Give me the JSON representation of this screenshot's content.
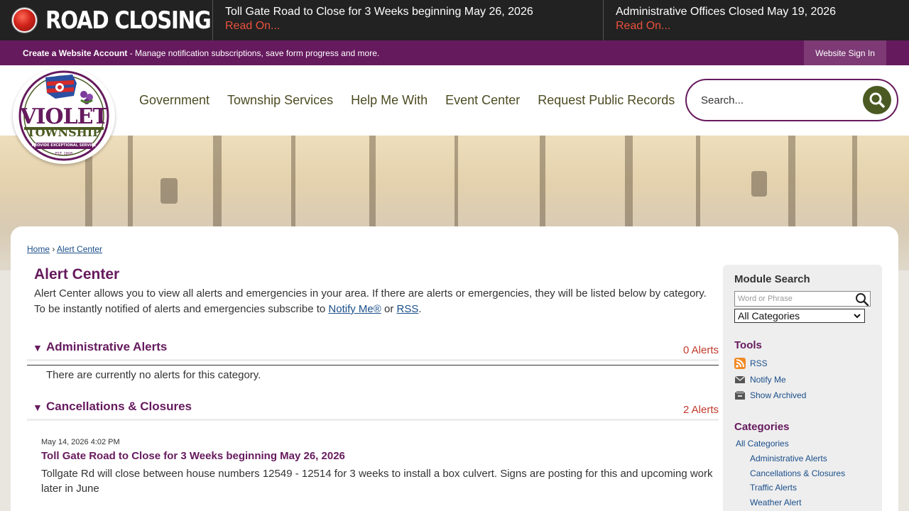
{
  "alert_bar": {
    "label": "ROAD CLOSING",
    "items": [
      {
        "title": "Toll Gate Road to Close for 3 Weeks beginning May 26, 2026",
        "link": "Read On..."
      },
      {
        "title": "Administrative Offices Closed May 19, 2026",
        "link": "Read On..."
      }
    ]
  },
  "account_bar": {
    "create_label": "Create a Website Account",
    "create_desc": " - Manage notification subscriptions, save form progress and more.",
    "signin_label": "Website Sign In"
  },
  "logo": {
    "text_top": "VIOLET",
    "text_bottom": "TOWNSHIP",
    "tagline": "PROVIDE EXCEPTIONAL SERVICE",
    "est": "EST. 1808"
  },
  "nav": {
    "items": [
      "Government",
      "Township Services",
      "Help Me With",
      "Event Center",
      "Request Public Records"
    ]
  },
  "search": {
    "placeholder": "Search..."
  },
  "breadcrumb": {
    "home": "Home",
    "sep": "›",
    "current": "Alert Center"
  },
  "page": {
    "title": "Alert Center",
    "intro_1": "Alert Center allows you to view all alerts and emergencies in your area. If there are alerts or emergencies, they will be listed below by category. To be instantly notified of alerts and emergencies subscribe to ",
    "notify_link": "Notify Me®",
    "or": " or ",
    "rss_link": "RSS",
    "period": "."
  },
  "categories": [
    {
      "toggle": "▼",
      "title": "Administrative Alerts",
      "count": "0 Alerts",
      "empty": "There are currently no alerts for this category."
    },
    {
      "toggle": "▼",
      "title": "Cancellations & Closures",
      "count": "2 Alerts"
    }
  ],
  "entry": {
    "date": "May 14, 2026 4:02 PM",
    "title": "Toll Gate Road to Close for 3 Weeks beginning May 26, 2026",
    "desc": "Tollgate Rd will close between house numbers 12549 - 12514 for 3 weeks to install a box culvert. Signs are posting for this and upcoming work later in June"
  },
  "sidebar": {
    "module_search": "Module Search",
    "input_placeholder": "Word or Phrase",
    "select_value": "All Categories",
    "tools_heading": "Tools",
    "tools": [
      "RSS",
      "Notify Me",
      "Show Archived"
    ],
    "categories_heading": "Categories",
    "all_categories": "All Categories",
    "category_links": [
      "Administrative Alerts",
      "Cancellations & Closures",
      "Traffic Alerts",
      "Weather Alert"
    ]
  },
  "colors": {
    "brand_purple": "#661a5e",
    "nav_text": "#4c4c24",
    "alert_red": "#e8513d",
    "link_blue": "#1a4e8a",
    "search_green": "#4a5a22"
  }
}
